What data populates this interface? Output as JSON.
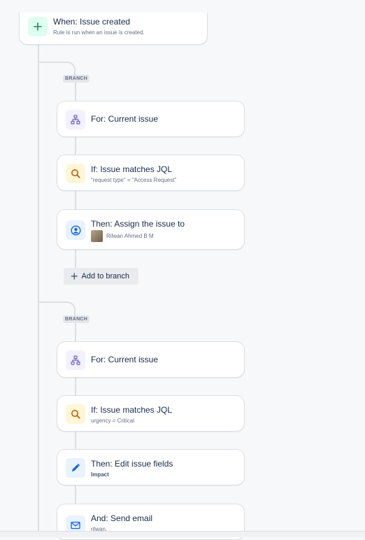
{
  "trigger": {
    "title": "When: Issue created",
    "description": "Rule is run when an issue is created.",
    "icon": "plus-icon",
    "color": "#1f845a"
  },
  "branches": [
    {
      "tag": "BRANCH",
      "for": {
        "title": "For: Current issue",
        "icon": "hierarchy-icon"
      },
      "condition": {
        "title": "If: Issue matches JQL",
        "detail": "\"request type\" = \"Access Request\"",
        "icon": "search-icon"
      },
      "action": {
        "title": "Then: Assign the issue to",
        "assignee": "Rilwan Ahmed B M",
        "icon": "user-circle-icon"
      },
      "add_label": "Add to branch"
    },
    {
      "tag": "BRANCH",
      "for": {
        "title": "For: Current issue",
        "icon": "hierarchy-icon"
      },
      "condition": {
        "title": "If: Issue matches JQL",
        "detail": "urgency = Critical",
        "icon": "search-icon"
      },
      "action": {
        "title": "Then: Edit issue fields",
        "detail": "Impact",
        "icon": "pencil-icon"
      },
      "action2": {
        "title": "And: Send email",
        "detail": "rilwan.",
        "icon": "envelope-icon"
      }
    }
  ],
  "colors": {
    "branch_icon_bg": "#f3f0ff",
    "branch_icon": "#6e5dc6",
    "condition_icon_bg": "#fff7d6",
    "condition_icon": "#c25100",
    "action_icon_bg": "#e9f2ff",
    "action_icon": "#0c66e4",
    "trigger_icon_bg": "#dcfff1"
  }
}
